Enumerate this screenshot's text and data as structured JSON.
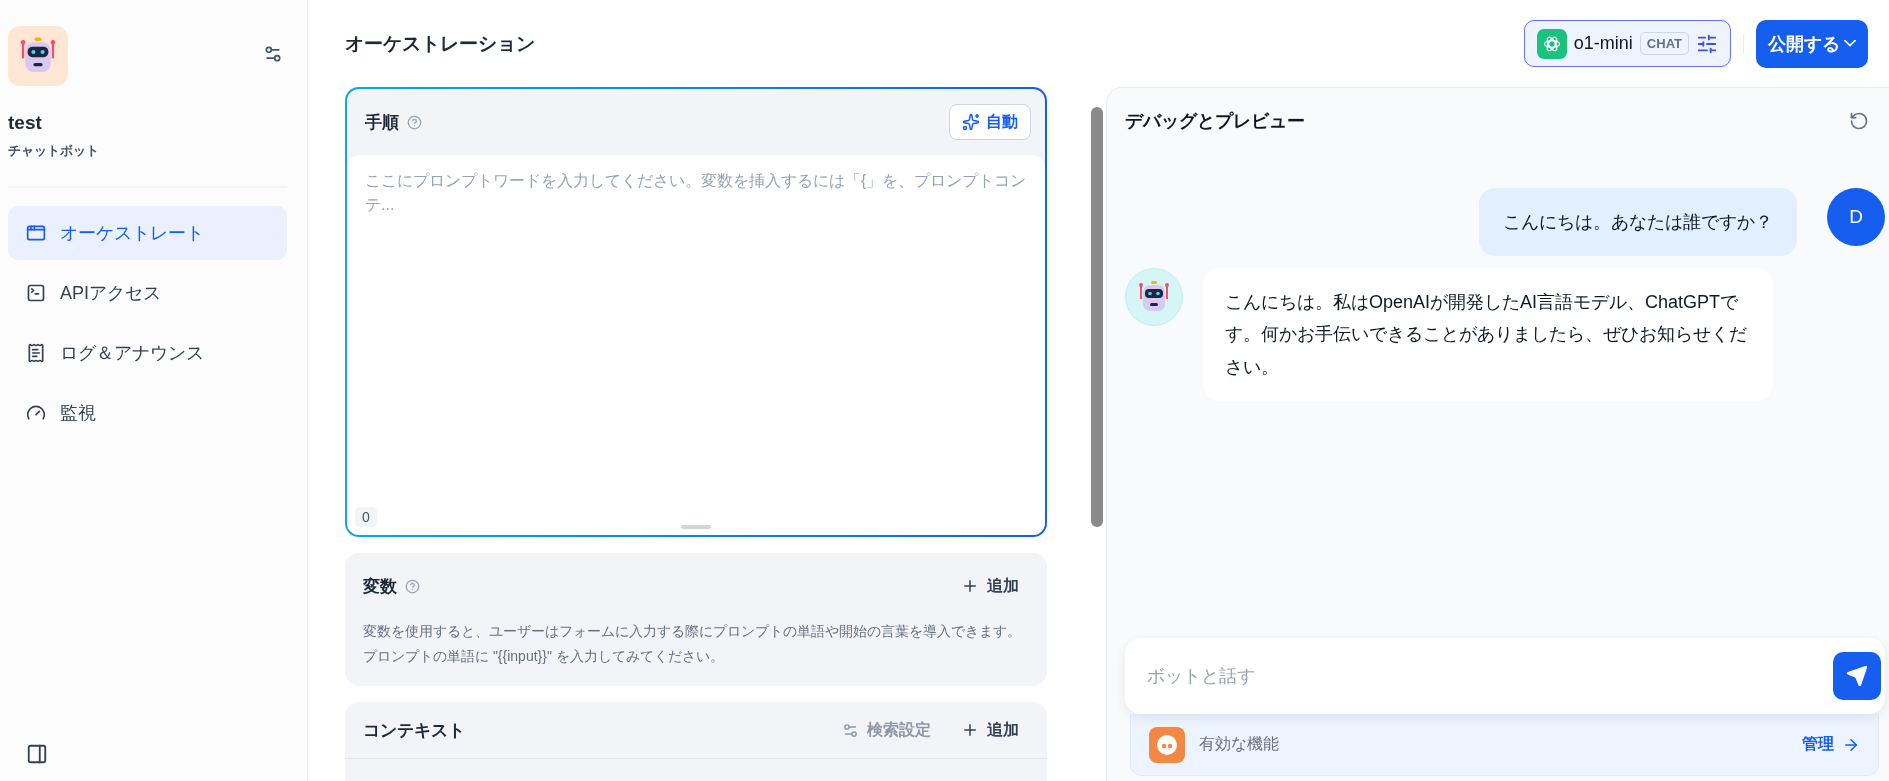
{
  "app": {
    "name": "test",
    "type": "チャットボット"
  },
  "nav": [
    {
      "label": "オーケストレート",
      "selected": true
    },
    {
      "label": "APIアクセス",
      "selected": false
    },
    {
      "label": "ログ＆アナウンス",
      "selected": false
    },
    {
      "label": "監視",
      "selected": false
    }
  ],
  "header": {
    "title": "オーケストレーション",
    "model": "o1-mini",
    "model_tag": "CHAT",
    "publish": "公開する"
  },
  "instructions": {
    "title": "手順",
    "auto_button": "自動",
    "placeholder": "ここにプロンプトワードを入力してください。変数を挿入するには「{」を、プロンプトコンテ...",
    "char_count": "0"
  },
  "variables": {
    "title": "変数",
    "add": "追加",
    "description": "変数を使用すると、ユーザーはフォームに入力する際にプロンプトの単語や開始の言葉を導入できます。プロンプトの単語に \"{{input}}\" を入力してみてください。"
  },
  "context": {
    "title": "コンテキスト",
    "retrieval_settings": {
      "label": "検索設定",
      "disabled": true
    },
    "add": "追加"
  },
  "debug": {
    "title": "デバッグとプレビュー",
    "messages": [
      {
        "kind": "user",
        "avatar": "D",
        "text": "こんにちは。あなたは誰ですか？"
      },
      {
        "kind": "bot",
        "text": "こんにちは。私はOpenAIが開発したAI言語モデル、ChatGPTです。何かお手伝いできることがありましたら、ぜひお知らせください。"
      }
    ],
    "input_placeholder": "ボットと話す",
    "features": {
      "label": "有効な機能",
      "manage": "管理"
    }
  }
}
